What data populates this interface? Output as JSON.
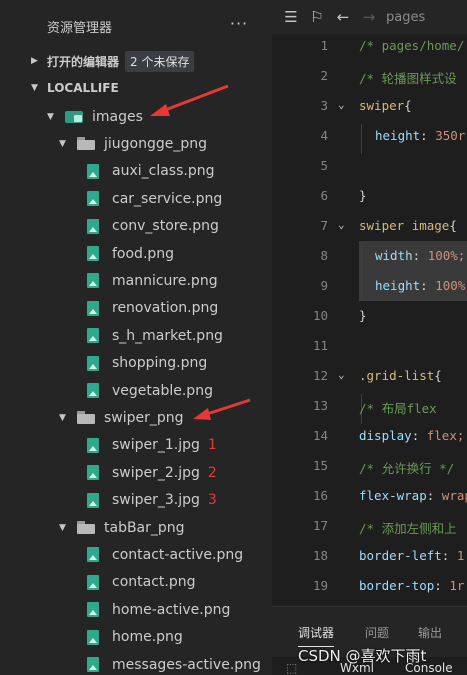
{
  "explorer": {
    "title": "资源管理器",
    "more": "···",
    "open_editors": {
      "label": "打开的编辑器",
      "badge": "2 个未保存"
    },
    "workspace": {
      "label": "LOCALLIFE"
    },
    "tree": [
      {
        "name": "images",
        "kind": "folder-img",
        "expanded": true
      },
      {
        "name": "jiugongge_png",
        "kind": "folder",
        "expanded": true
      },
      {
        "name": "auxi_class.png",
        "kind": "file"
      },
      {
        "name": "car_service.png",
        "kind": "file"
      },
      {
        "name": "conv_store.png",
        "kind": "file"
      },
      {
        "name": "food.png",
        "kind": "file"
      },
      {
        "name": "mannicure.png",
        "kind": "file"
      },
      {
        "name": "renovation.png",
        "kind": "file"
      },
      {
        "name": "s_h_market.png",
        "kind": "file"
      },
      {
        "name": "shopping.png",
        "kind": "file"
      },
      {
        "name": "vegetable.png",
        "kind": "file"
      },
      {
        "name": "swiper_png",
        "kind": "folder",
        "expanded": true
      },
      {
        "name": "swiper_1.jpg",
        "kind": "file",
        "annotation": "1"
      },
      {
        "name": "swiper_2.jpg",
        "kind": "file",
        "annotation": "2"
      },
      {
        "name": "swiper_3.jpg",
        "kind": "file",
        "annotation": "3"
      },
      {
        "name": "tabBar_png",
        "kind": "folder",
        "expanded": true
      },
      {
        "name": "contact-active.png",
        "kind": "file"
      },
      {
        "name": "contact.png",
        "kind": "file"
      },
      {
        "name": "home-active.png",
        "kind": "file"
      },
      {
        "name": "home.png",
        "kind": "file"
      },
      {
        "name": "messages-active.png",
        "kind": "file"
      }
    ]
  },
  "editor": {
    "toolbar": {
      "path": "pages"
    },
    "lines": [
      {
        "n": "1",
        "text": "/* pages/home/"
      },
      {
        "n": "2",
        "text": "/* 轮播图样式设"
      },
      {
        "n": "3",
        "sel": "swiper",
        "brace": "{"
      },
      {
        "n": "4",
        "prop": "height",
        "val": "350r"
      },
      {
        "n": "5"
      },
      {
        "n": "6",
        "close": "}"
      },
      {
        "n": "7",
        "sel": "swiper",
        "tag": "image",
        "brace": "{"
      },
      {
        "n": "8",
        "prop": "width",
        "val": "100%;"
      },
      {
        "n": "9",
        "prop": "height",
        "val": "100%"
      },
      {
        "n": "10",
        "close": "}"
      },
      {
        "n": "11"
      },
      {
        "n": "12",
        "sel": ".grid-list",
        "brace": "{"
      },
      {
        "n": "13",
        "text": "  /* 布局flex"
      },
      {
        "n": "14",
        "prop": "display",
        "val": "flex;"
      },
      {
        "n": "15",
        "text": "/* 允许换行 */"
      },
      {
        "n": "16",
        "prop": "flex-wrap",
        "val": "wrap"
      },
      {
        "n": "17",
        "text": "/* 添加左侧和上"
      },
      {
        "n": "18",
        "prop": "border-left",
        "val": "1"
      },
      {
        "n": "19",
        "prop": "border-top",
        "val": "1r"
      }
    ]
  },
  "panel": {
    "tabs": [
      "调试器",
      "问题",
      "输出"
    ],
    "sub": [
      "Wxml",
      "Console"
    ]
  },
  "watermark": "CSDN @喜欢下雨t",
  "colors": {
    "arrow": "#e53935",
    "comment": "#6a9955",
    "selector": "#d7ba7d",
    "property": "#9cdcfe",
    "value": "#ce9178"
  }
}
